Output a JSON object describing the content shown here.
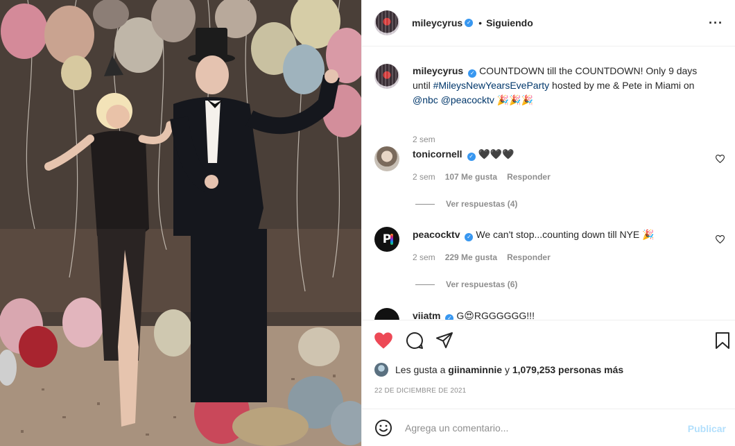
{
  "photo": {
    "alt_subject": "party-photo"
  },
  "header": {
    "username": "mileycyrus",
    "dot": "•",
    "follow_status": "Siguiendo",
    "more_icon": "more-horizontal-icon"
  },
  "caption": {
    "username": "mileycyrus",
    "text_a": "COUNTDOWN till the COUNTDOWN! Only 9 days until ",
    "hashtag": "#MileysNewYearsEveParty",
    "text_b": " hosted by me & Pete in Miami on ",
    "mention1": "@nbc",
    "mention2": "@peacocktv",
    "emoji": "🎉🎉🎉",
    "time": "2 sem"
  },
  "comments": [
    {
      "username": "tonicornell",
      "text": "🖤🖤🖤",
      "time": "2 sem",
      "likes": "107 Me gusta",
      "reply": "Responder",
      "view_replies": "Ver respuestas (4)"
    },
    {
      "username": "peacocktv",
      "text": "We can't stop...counting down till NYE 🎉",
      "time": "2 sem",
      "likes": "229 Me gusta",
      "reply": "Responder",
      "view_replies": "Ver respuestas (6)"
    },
    {
      "username": "viiatm",
      "text": "G😍RGGGGGG!!!"
    }
  ],
  "likes": {
    "prefix": "Les gusta a ",
    "user": "giinaminnie",
    "middle": " y ",
    "count": "1,079,253 personas más"
  },
  "date": "22 DE DICIEMBRE DE 2021",
  "add_comment": {
    "placeholder": "Agrega un comentario...",
    "publish": "Publicar"
  },
  "colors": {
    "like_red": "#ed4956",
    "verified_blue": "#3897f0",
    "link_blue": "#00376b",
    "publish_disabled": "#b2dffc"
  }
}
